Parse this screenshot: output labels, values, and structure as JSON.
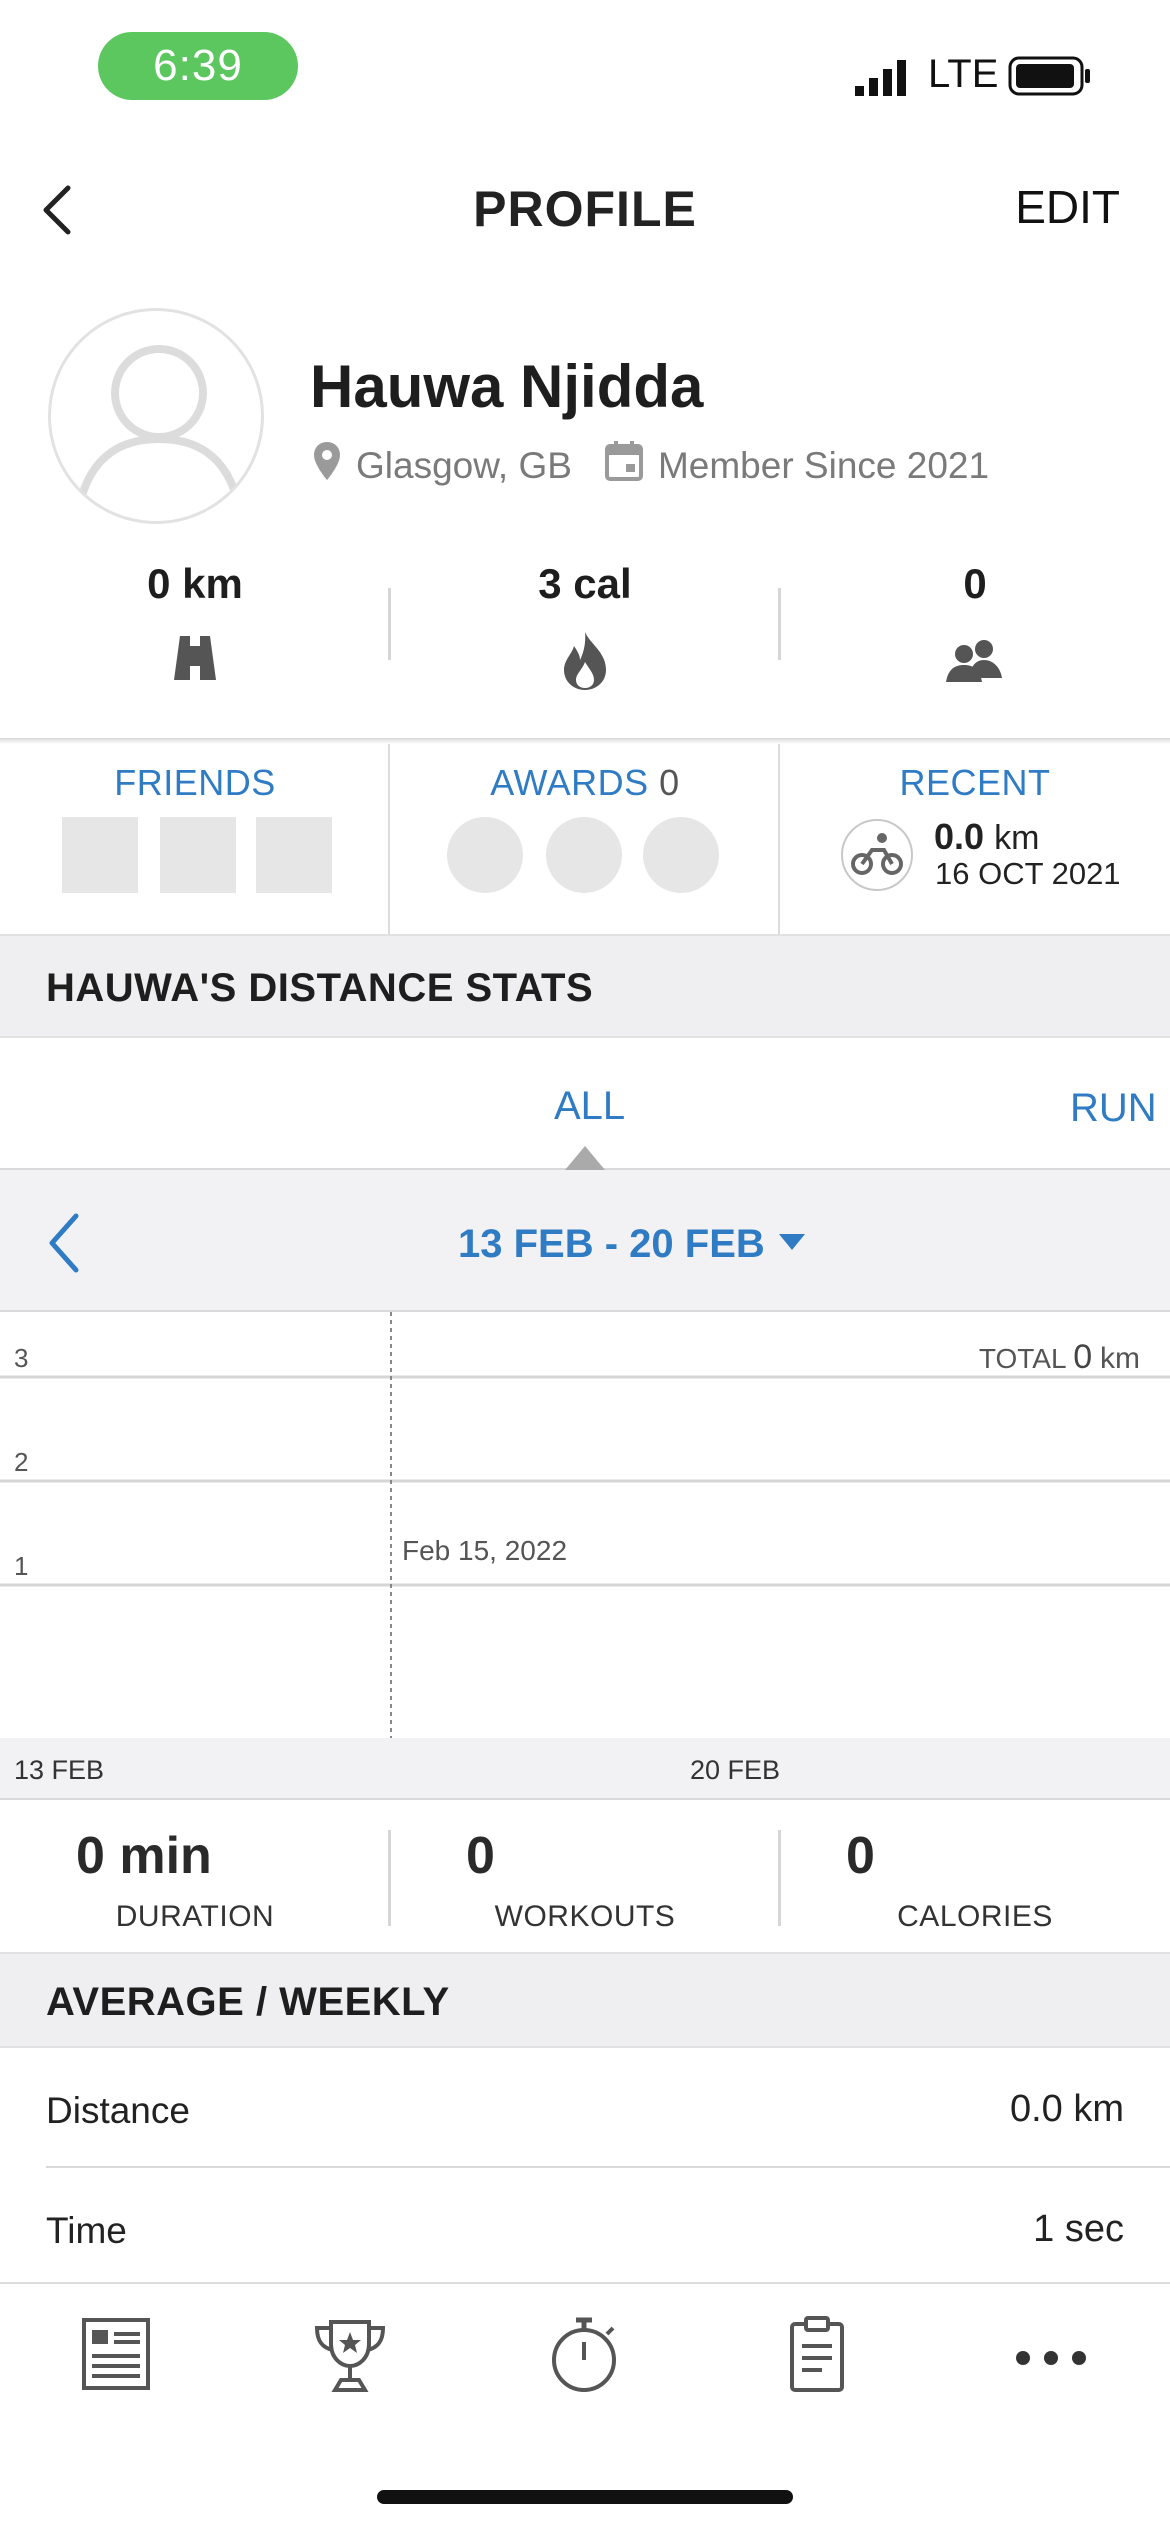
{
  "status_bar": {
    "time": "6:39",
    "network": "LTE"
  },
  "header": {
    "title": "PROFILE",
    "edit_label": "EDIT"
  },
  "profile": {
    "name": "Hauwa Njidda",
    "location": "Glasgow, GB",
    "member_since": "Member Since 2021"
  },
  "summary": {
    "distance": "0 km",
    "calories": "3 cal",
    "friends_count": "0"
  },
  "tiles": {
    "friends_label": "FRIENDS",
    "awards_label": "AWARDS",
    "awards_count": "0",
    "recent_label": "RECENT",
    "recent_distance": "0.0",
    "recent_unit": "km",
    "recent_date": "16 OCT 2021"
  },
  "distance_stats": {
    "title": "HAUWA'S DISTANCE STATS",
    "tabs": [
      "ALL",
      "RUN"
    ],
    "active_tab": "ALL",
    "date_range": "13 FEB - 20 FEB"
  },
  "chart_data": {
    "type": "line",
    "x_start": "13 FEB",
    "x_end": "20 FEB",
    "x_ticks": [
      "13 FEB",
      "20 FEB"
    ],
    "y_ticks": [
      "3",
      "2",
      "1"
    ],
    "ylim": [
      0,
      3.5
    ],
    "total_label": "TOTAL",
    "total_value": "0",
    "total_unit": "km",
    "marker_label": "Feb 15, 2022",
    "series": []
  },
  "week_stats": {
    "duration_value": "0 min",
    "duration_label": "DURATION",
    "workouts_value": "0",
    "workouts_label": "WORKOUTS",
    "calories_value": "0",
    "calories_label": "CALORIES"
  },
  "averages": {
    "title": "AVERAGE / WEEKLY",
    "rows": [
      {
        "label": "Distance",
        "value": "0.0 km"
      },
      {
        "label": "Time",
        "value": "1 sec"
      }
    ]
  },
  "nav": {
    "icons": [
      "feed-icon",
      "trophy-icon",
      "stopwatch-icon",
      "clipboard-icon",
      "more-icon"
    ]
  },
  "colors": {
    "accent": "#2f7bc4",
    "status_pill": "#5cc65f"
  }
}
